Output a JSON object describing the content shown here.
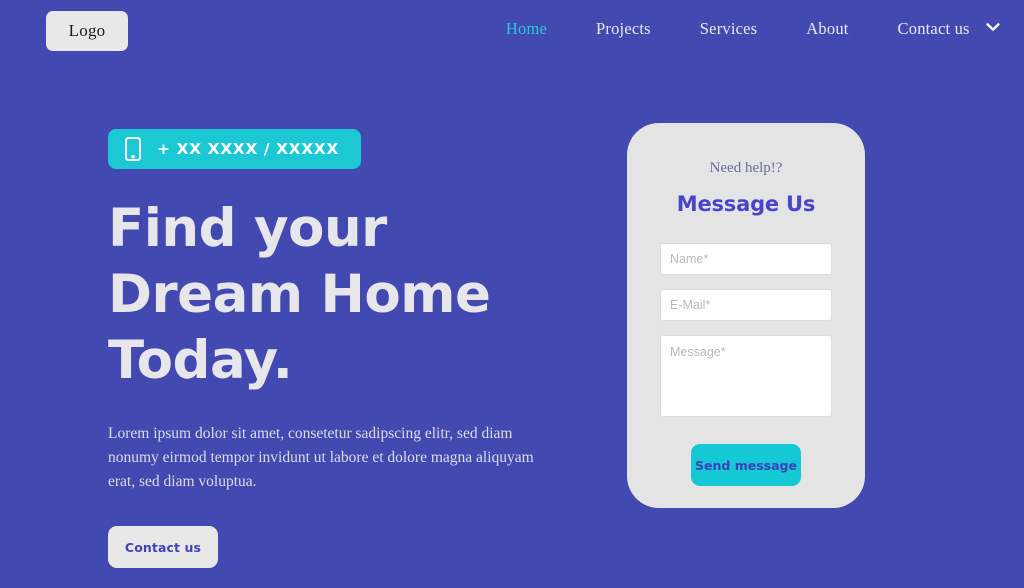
{
  "theme": {
    "background_blue": "#4249B1",
    "accent_teal": "#14C9D4",
    "card_gray": "#E4E4E4",
    "headline_color": "#E7E7EB",
    "title_blue": "#4845C8"
  },
  "header": {
    "logo_label": "Logo",
    "nav": [
      {
        "label": "Home",
        "active": true
      },
      {
        "label": "Projects",
        "active": false
      },
      {
        "label": "Services",
        "active": false
      },
      {
        "label": "About",
        "active": false
      },
      {
        "label": "Contact us",
        "active": false
      }
    ],
    "nav_caret_icon": "chevron-down-icon"
  },
  "hero": {
    "badge": {
      "icon": "mobile-phone-icon",
      "phone_number": "+ XX XXXX / XXXXX"
    },
    "headline": "Find your Dream Home Today.",
    "subtext": "Lorem ipsum dolor sit amet, consetetur sadipscing elitr, sed diam nonumy eirmod tempor invidunt ut labore et dolore magna aliquyam erat, sed diam voluptua.",
    "cta_label": "Contact us"
  },
  "contact_card": {
    "eyebrow": "Need help!?",
    "title": "Message Us",
    "fields": {
      "name_placeholder": "Name*",
      "email_placeholder": "E-Mail*",
      "message_placeholder": "Message*",
      "name_value": "",
      "email_value": "",
      "message_value": ""
    },
    "submit_label": "Send message"
  }
}
